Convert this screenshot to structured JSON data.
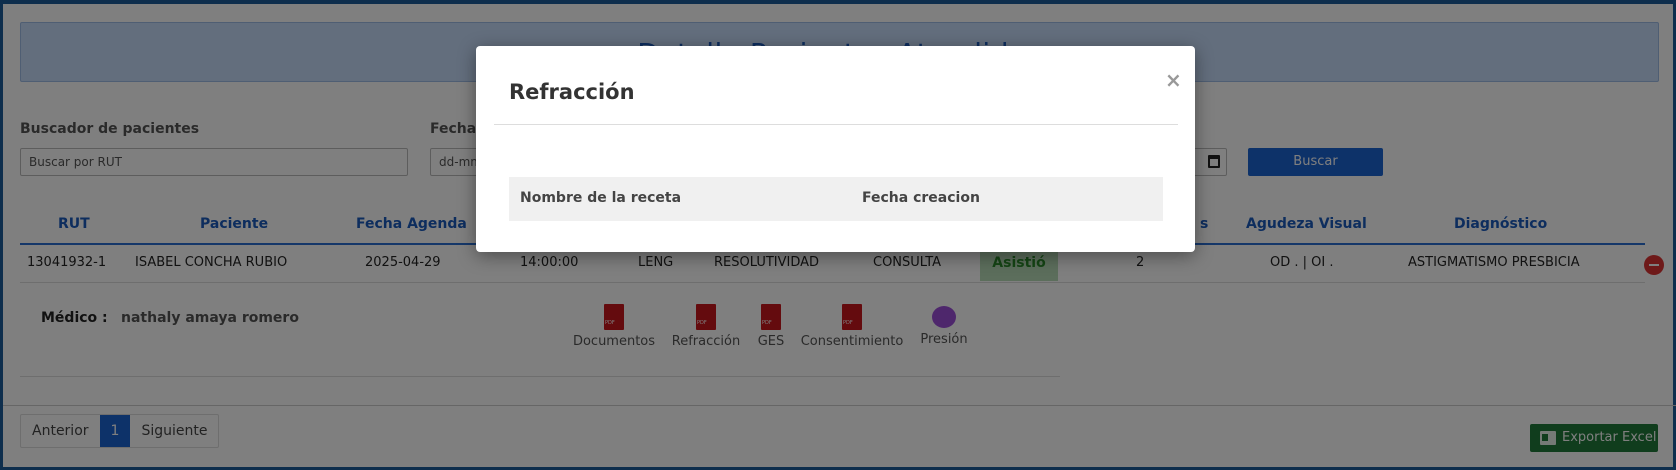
{
  "page": {
    "title": "Detalle Pacientes Atendidos"
  },
  "filters": {
    "search_label": "Buscador de pacientes",
    "search_placeholder": "Buscar por RUT",
    "date_label": "Fecha",
    "date_placeholder": "dd-mm",
    "search_button": "Buscar"
  },
  "table": {
    "headers": {
      "rut": "RUT",
      "paciente": "Paciente",
      "fecha_agenda": "Fecha Agenda",
      "hidden_s": "s",
      "agudeza": "Agudeza Visual",
      "diagnostico": "Diagnóstico"
    },
    "row": {
      "rut": "13041932-1",
      "paciente": "ISABEL CONCHA RUBIO",
      "fecha": "2025-04-29",
      "hora": "14:00:00",
      "cod": "LENG",
      "tipo": "RESOLUTIVIDAD",
      "motivo": "CONSULTA",
      "estado": "Asistió",
      "cantidad": "2",
      "agudeza": "OD . | OI .",
      "diagnostico": "ASTIGMATISMO PRESBICIA"
    }
  },
  "detail": {
    "medico_label": "Médico :",
    "medico_value": "nathaly amaya romero",
    "documents": [
      {
        "label": "Documentos",
        "icon": "pdf-icon"
      },
      {
        "label": "Refracción",
        "icon": "pdf-icon"
      },
      {
        "label": "GES",
        "icon": "pdf-icon"
      },
      {
        "label": "Consentimiento",
        "icon": "pdf-icon"
      },
      {
        "label": "Presión",
        "icon": "pressure-icon"
      }
    ]
  },
  "pagination": {
    "prev": "Anterior",
    "current": "1",
    "next": "Siguiente"
  },
  "export": {
    "label": "Exportar Excel"
  },
  "modal": {
    "title": "Refracción",
    "close": "×",
    "columns": [
      "Nombre de la receta",
      "Fecha creacion"
    ]
  },
  "colors": {
    "accent": "#1b64d3",
    "banner": "#c7dcfb",
    "status_ok": "#b9dcb9",
    "excel": "#207a3a",
    "danger": "#dd3333"
  }
}
